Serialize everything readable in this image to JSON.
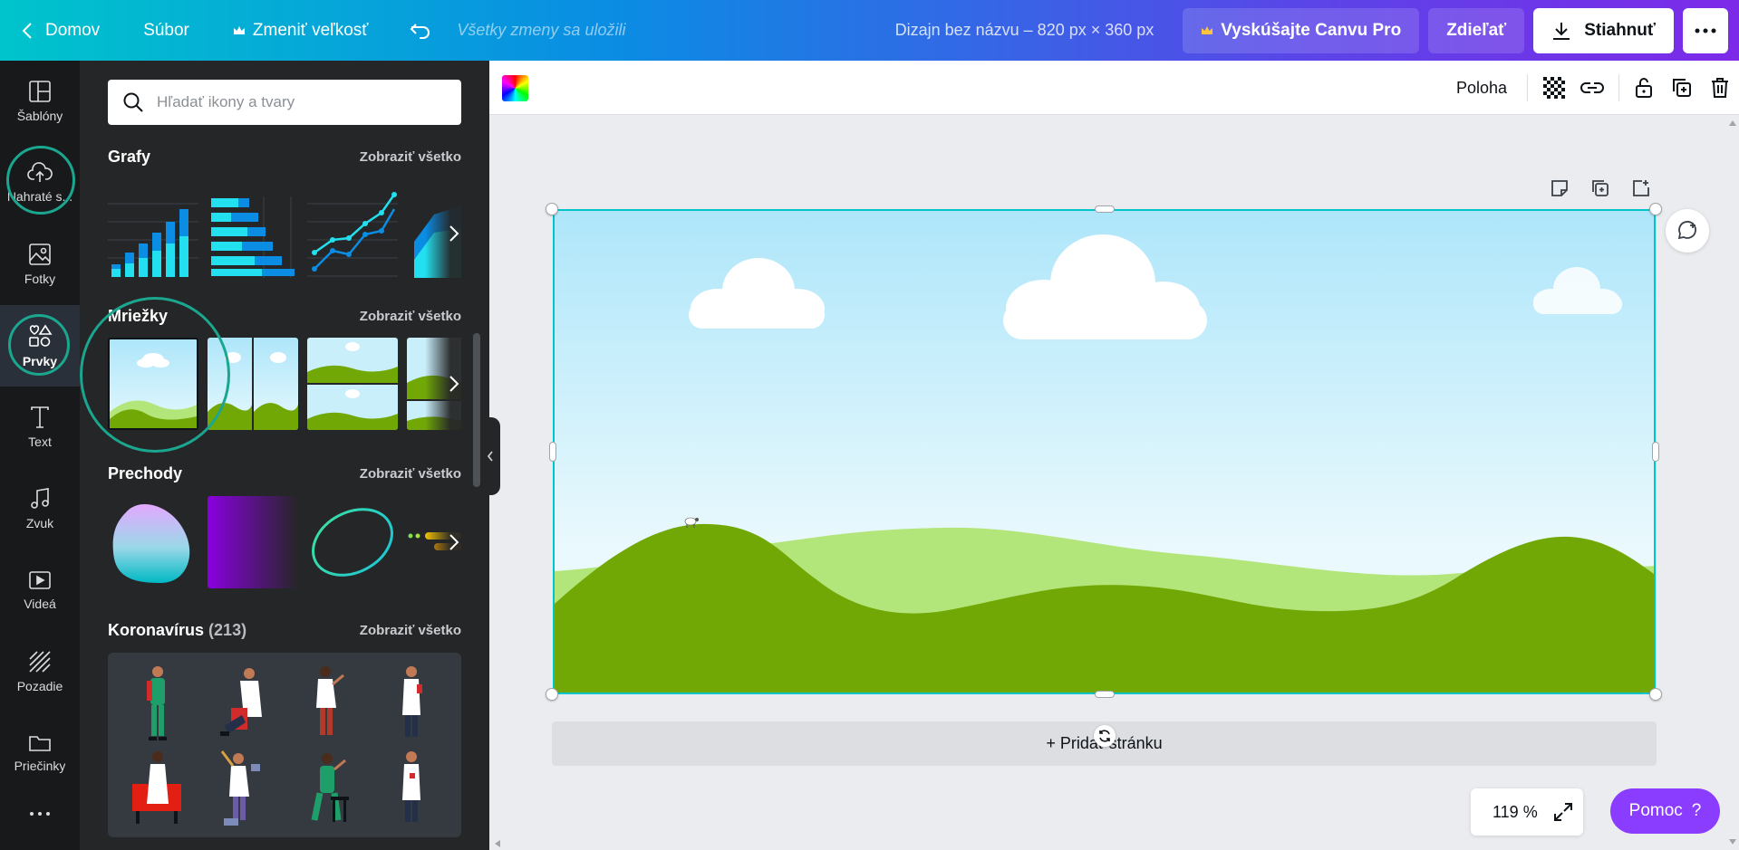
{
  "topbar": {
    "home_label": "Domov",
    "file_label": "Súbor",
    "resize_label": "Zmeniť veľkosť",
    "saved_status": "Všetky zmeny sa uložili",
    "design_title": "Dizajn bez názvu – 820 px × 360 px",
    "pro_label": "Vyskúšajte Canvu Pro",
    "share_label": "Zdieľať",
    "download_label": "Stiahnuť",
    "more_icon": "more-horizontal-icon"
  },
  "rail": {
    "items": [
      {
        "label": "Šablóny",
        "icon": "templates-icon"
      },
      {
        "label": "Nahraté s...",
        "icon": "upload-cloud-icon"
      },
      {
        "label": "Fotky",
        "icon": "photo-icon"
      },
      {
        "label": "Prvky",
        "icon": "elements-icon",
        "active": true
      },
      {
        "label": "Text",
        "icon": "text-icon"
      },
      {
        "label": "Zvuk",
        "icon": "music-icon"
      },
      {
        "label": "Videá",
        "icon": "video-icon"
      },
      {
        "label": "Pozadie",
        "icon": "background-icon"
      },
      {
        "label": "Priečinky",
        "icon": "folder-icon"
      }
    ]
  },
  "panel": {
    "search_placeholder": "Hľadať ikony a tvary",
    "show_all": "Zobraziť všetko",
    "sections": {
      "charts": "Grafy",
      "grids": "Mriežky",
      "gradients": "Prechody",
      "corona": "Koronavírus",
      "corona_count": "(213)"
    }
  },
  "canvas": {
    "position_label": "Poloha",
    "add_page_label": "+ Pridať stránku",
    "zoom_value": "119 %",
    "help_label": "Pomoc",
    "help_mark": "?"
  },
  "colors": {
    "accent_teal": "#00c4cc",
    "highlight_circle": "#1aa68f",
    "help_purple": "#8b3dff",
    "sky_top": "#aee6fa",
    "grass_dark": "#71a806",
    "grass_light": "#b3e67a"
  }
}
